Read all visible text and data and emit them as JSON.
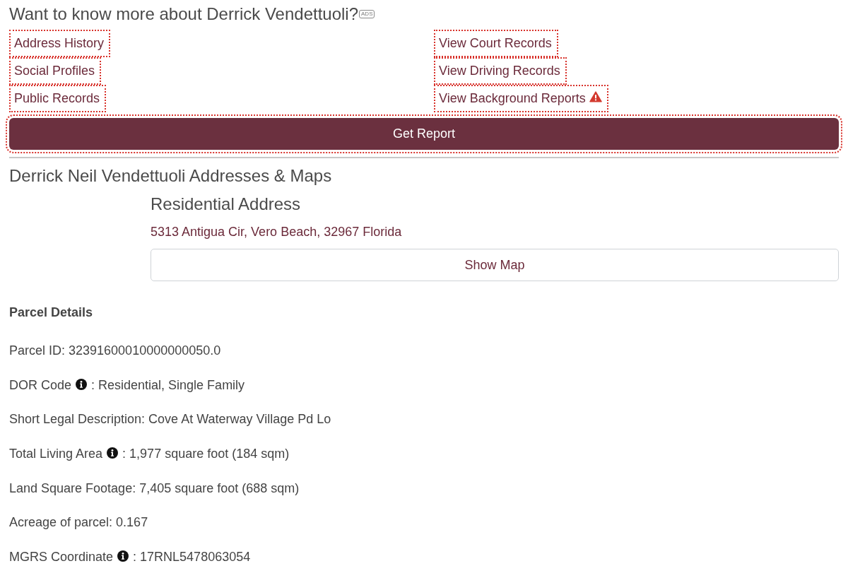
{
  "promo": {
    "title": "Want to know more about Derrick Vendettuoli?",
    "badge": "ADS",
    "columns": [
      {
        "links": [
          {
            "label": "Address History",
            "kind": "plain"
          },
          {
            "label": "Social Profiles",
            "kind": "plain"
          },
          {
            "label": "Public Records",
            "kind": "plain"
          }
        ]
      },
      {
        "links": [
          {
            "label": "View Court Records",
            "kind": "plain"
          },
          {
            "label": "View Driving Records",
            "kind": "plain"
          },
          {
            "label": "View Background Reports",
            "kind": "alert"
          }
        ]
      }
    ],
    "button": "Get Report"
  },
  "addresses": {
    "heading": "Derrick Neil Vendettuoli Addresses & Maps",
    "type_label": "Residential Address",
    "address": "5313 Antigua Cir, Vero Beach, 32967 Florida",
    "map_button": "Show Map"
  },
  "parcel": {
    "title": "Parcel Details",
    "rows": [
      {
        "label": "Parcel ID:",
        "info": false,
        "value": "32391600010000000050.0"
      },
      {
        "label": "DOR Code",
        "info": true,
        "value": ": Residential, Single Family"
      },
      {
        "label": "Short Legal Description:",
        "info": false,
        "value": "Cove At Waterway Village Pd Lo"
      },
      {
        "label": "Total Living Area",
        "info": true,
        "value": ": 1,977 square foot (184 sqm)"
      },
      {
        "label": "Land Square Footage:",
        "info": false,
        "value": "7,405 square foot (688 sqm)"
      },
      {
        "label": "Acreage of parcel:",
        "info": false,
        "value": "0.167"
      },
      {
        "label": "MGRS Coordinate",
        "info": true,
        "value": ": 17RNL5478063054"
      }
    ]
  }
}
